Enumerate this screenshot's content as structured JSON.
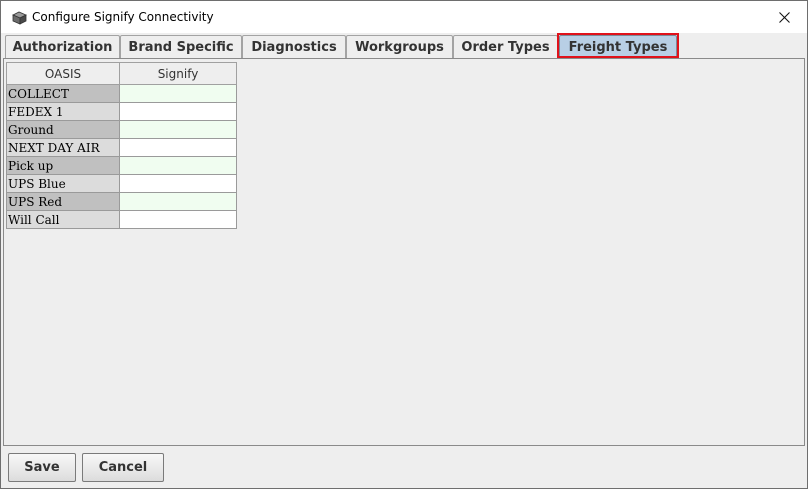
{
  "window": {
    "title": "Configure Signify Connectivity",
    "icon": "app-box-icon",
    "close_icon": "close-icon"
  },
  "tabs": [
    {
      "label": "Authorization",
      "selected": false
    },
    {
      "label": "Brand Specific",
      "selected": false
    },
    {
      "label": "Diagnostics",
      "selected": false
    },
    {
      "label": "Workgroups",
      "selected": false
    },
    {
      "label": "Order Types",
      "selected": false
    },
    {
      "label": "Freight Types",
      "selected": true
    }
  ],
  "highlight_color": "#e0121b",
  "table": {
    "headers": [
      "OASIS",
      "Signify"
    ],
    "rows": [
      {
        "oasis": "COLLECT",
        "signify": ""
      },
      {
        "oasis": "FEDEX 1",
        "signify": ""
      },
      {
        "oasis": "Ground",
        "signify": ""
      },
      {
        "oasis": "NEXT DAY AIR",
        "signify": ""
      },
      {
        "oasis": "Pick up",
        "signify": ""
      },
      {
        "oasis": "UPS Blue",
        "signify": ""
      },
      {
        "oasis": "UPS Red",
        "signify": ""
      },
      {
        "oasis": "Will Call",
        "signify": ""
      }
    ]
  },
  "buttons": {
    "save_label": "Save",
    "cancel_label": "Cancel"
  }
}
